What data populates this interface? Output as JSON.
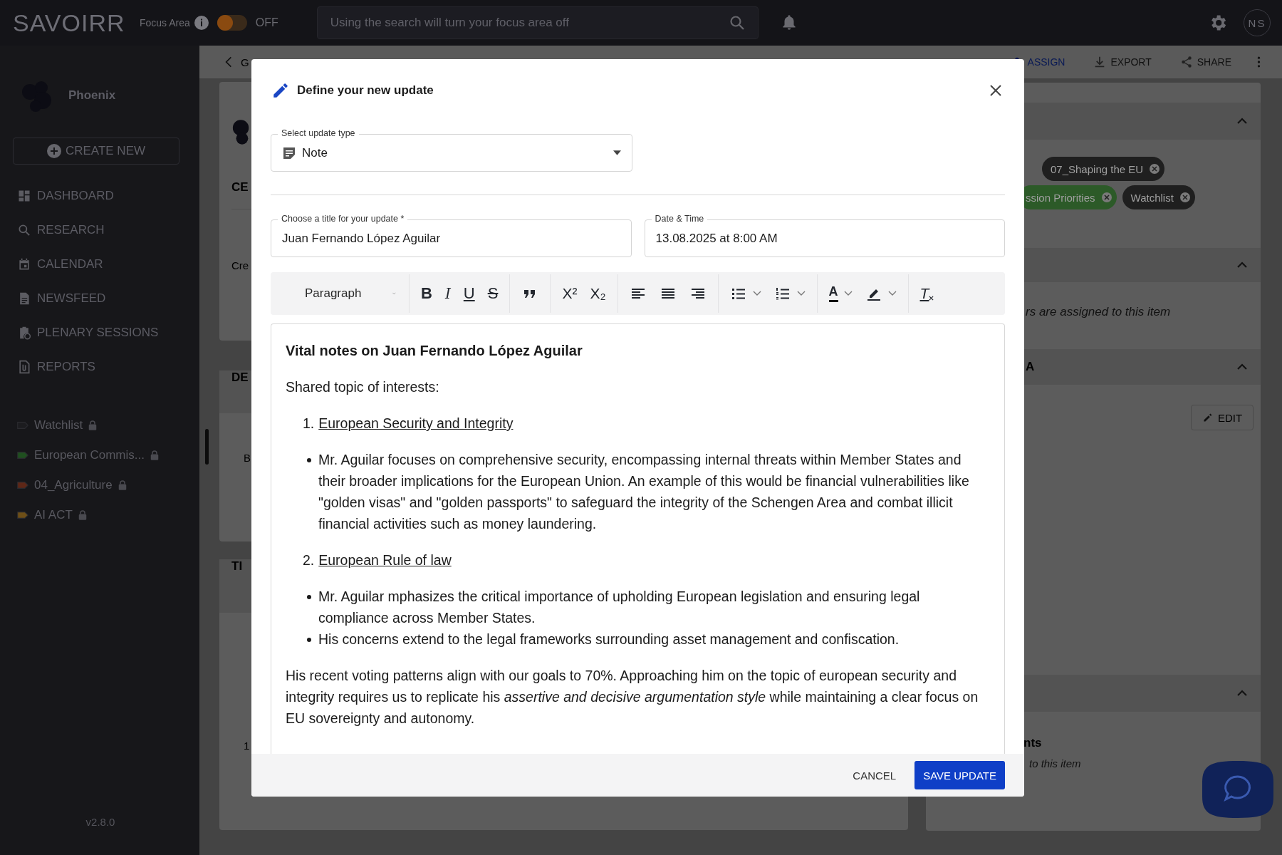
{
  "top_bar": {
    "logo": "SAVOIRR",
    "focus_label": "Focus Area",
    "focus_toggle": {
      "on": false,
      "label": "OFF"
    },
    "search": {
      "placeholder": "Using the search will turn your focus area off"
    },
    "avatar": "NS"
  },
  "sidebar": {
    "workspace": "Phoenix",
    "create_button": "CREATE NEW",
    "nav": [
      {
        "label": "DASHBOARD"
      },
      {
        "label": "RESEARCH"
      },
      {
        "label": "CALENDAR"
      },
      {
        "label": "NEWSFEED"
      },
      {
        "label": "PLENARY SESSIONS"
      },
      {
        "label": "REPORTS"
      }
    ],
    "lists": [
      {
        "label": "Watchlist",
        "color": "#1c1c1f",
        "locked": true
      },
      {
        "label": "European Commis...",
        "color": "#1f4f1f",
        "locked": true
      },
      {
        "label": "04_Agriculture",
        "color": "#5e2717",
        "locked": true
      },
      {
        "label": "AI ACT",
        "color": "#6e4f17",
        "locked": true
      }
    ],
    "version": "v2.8.0"
  },
  "page": {
    "back": "G",
    "actions": [
      {
        "kind": "assign",
        "label": "ASSIGN"
      },
      {
        "kind": "export",
        "label": "EXPORT"
      },
      {
        "kind": "share",
        "label": "SHARE"
      }
    ],
    "cards": [
      {
        "heading": "CE",
        "text": "Cre"
      },
      {
        "heading": "DE",
        "text": "B"
      },
      {
        "heading": "TI",
        "text": "1"
      }
    ]
  },
  "right_panel": {
    "chip_rows": [
      [
        {
          "label": "07_Shaping the EU",
          "color": "#1f1f1f"
        }
      ],
      [
        {
          "label": "ssion Priorities",
          "color": "#2c5a28"
        },
        {
          "label": "Watchlist",
          "color": "#1f1f1f"
        }
      ]
    ],
    "assignees_note": "rs are assigned to this item",
    "section_heading": "A",
    "edit_button": "EDIT",
    "bottom_heading": "nts",
    "bottom_note": "to this item"
  },
  "dialog": {
    "title": "Define your new update",
    "type_field": {
      "label": "Select update type",
      "value": "Note"
    },
    "title_field": {
      "label": "Choose a title for your update *",
      "value": "Juan Fernando López Aguilar"
    },
    "date_field": {
      "label": "Date & Time",
      "value": "13.08.2025 at 8:00 AM"
    },
    "toolbar": {
      "block_style": "Paragraph",
      "groups": [
        [
          {
            "kind": "bold",
            "glyph": "B"
          },
          {
            "kind": "italic",
            "glyph": "I"
          },
          {
            "kind": "underline",
            "glyph": "U"
          },
          {
            "kind": "strike",
            "glyph": "S"
          }
        ],
        [
          {
            "kind": "quote"
          }
        ],
        [
          {
            "kind": "superscript",
            "glyph": "X²"
          },
          {
            "kind": "subscript",
            "glyph": "X₂"
          }
        ],
        [
          {
            "kind": "align-left"
          },
          {
            "kind": "align-center"
          },
          {
            "kind": "align-right"
          }
        ],
        [
          {
            "kind": "bullet-list",
            "dropdown": true
          },
          {
            "kind": "numbered-list",
            "dropdown": true
          }
        ],
        [
          {
            "kind": "text-color",
            "glyph": "A",
            "dropdown": true
          },
          {
            "kind": "highlight",
            "dropdown": true
          }
        ],
        [
          {
            "kind": "clear-format",
            "glyph": "T"
          }
        ]
      ]
    },
    "content": [
      {
        "kind": "heading",
        "text": "Vital notes on Juan Fernando López Aguilar"
      },
      {
        "kind": "paragraph",
        "text": "Shared topic of interests:"
      },
      {
        "kind": "numbered",
        "number": "1.",
        "text": "European Security and Integrity "
      },
      {
        "kind": "bullets",
        "items": [
          "Mr. Aguilar focuses on comprehensive security, encompassing internal threats within Member States and their broader implications for the European Union. An example of this would be financial vulnerabilities like \"golden visas\" and \"golden passports\" to safeguard the integrity of the Schengen Area and combat illicit financial activities such as money laundering."
        ]
      },
      {
        "kind": "numbered",
        "number": "2.",
        "text": "European Rule of law "
      },
      {
        "kind": "bullets",
        "items": [
          "Mr. Aguilar mphasizes the critical importance of upholding European legislation and ensuring legal compliance across Member States.",
          "His concerns extend to the legal frameworks surrounding asset management and confiscation."
        ]
      },
      {
        "kind": "paragraph",
        "text": "His recent voting patterns align with our goals to 70%. Approaching him on the topic of european security and integrity requires us to replicate his *assertive and decisive argumentation style* while maintaining a clear focus on EU sovereignty and autonomy."
      }
    ],
    "cancel_button": "CANCEL",
    "save_button": "SAVE UPDATE"
  }
}
